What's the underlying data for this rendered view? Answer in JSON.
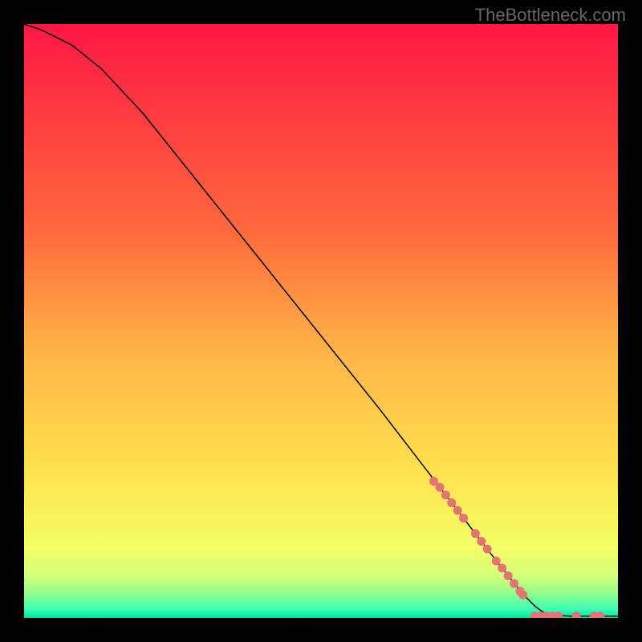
{
  "watermark": "TheBottleneck.com",
  "chart_data": {
    "type": "line",
    "title": "",
    "xlabel": "",
    "ylabel": "",
    "xlim": [
      0,
      100
    ],
    "ylim": [
      0,
      100
    ],
    "gradient_background": {
      "stops": [
        {
          "offset": 0.0,
          "color": "#ff1744"
        },
        {
          "offset": 0.35,
          "color": "#ff6a3d"
        },
        {
          "offset": 0.55,
          "color": "#ffb347"
        },
        {
          "offset": 0.75,
          "color": "#ffe14d"
        },
        {
          "offset": 0.88,
          "color": "#f5ff66"
        },
        {
          "offset": 0.93,
          "color": "#d4ff7a"
        },
        {
          "offset": 0.96,
          "color": "#8fff8f"
        },
        {
          "offset": 0.985,
          "color": "#3dffb3"
        },
        {
          "offset": 1.0,
          "color": "#00e5a0"
        }
      ]
    },
    "curve": {
      "points": [
        {
          "x": 0,
          "y": 100
        },
        {
          "x": 3,
          "y": 99
        },
        {
          "x": 8,
          "y": 96.5
        },
        {
          "x": 13,
          "y": 92.5
        },
        {
          "x": 20,
          "y": 85
        },
        {
          "x": 30,
          "y": 72.5
        },
        {
          "x": 40,
          "y": 60
        },
        {
          "x": 50,
          "y": 47.5
        },
        {
          "x": 60,
          "y": 35
        },
        {
          "x": 70,
          "y": 22
        },
        {
          "x": 75,
          "y": 15.5
        },
        {
          "x": 80,
          "y": 9
        },
        {
          "x": 84,
          "y": 4
        },
        {
          "x": 86,
          "y": 2
        },
        {
          "x": 88,
          "y": 0.5
        },
        {
          "x": 92,
          "y": 0.3
        },
        {
          "x": 100,
          "y": 0.3
        }
      ]
    },
    "markers": {
      "color": "#e57373",
      "radius": 5.5,
      "points": [
        {
          "x": 69,
          "y": 23
        },
        {
          "x": 70,
          "y": 22
        },
        {
          "x": 71,
          "y": 20.7
        },
        {
          "x": 72,
          "y": 19.4
        },
        {
          "x": 73,
          "y": 18.1
        },
        {
          "x": 74,
          "y": 16.8
        },
        {
          "x": 76,
          "y": 14.2
        },
        {
          "x": 77,
          "y": 12.9
        },
        {
          "x": 78,
          "y": 11.6
        },
        {
          "x": 79.5,
          "y": 9.6
        },
        {
          "x": 80.5,
          "y": 8.4
        },
        {
          "x": 81.5,
          "y": 7.1
        },
        {
          "x": 82.5,
          "y": 5.8
        },
        {
          "x": 83.5,
          "y": 4.5
        },
        {
          "x": 84,
          "y": 3.9
        },
        {
          "x": 86,
          "y": 0.3
        },
        {
          "x": 87,
          "y": 0.3
        },
        {
          "x": 88,
          "y": 0.3
        },
        {
          "x": 89,
          "y": 0.3
        },
        {
          "x": 90,
          "y": 0.3
        },
        {
          "x": 93,
          "y": 0.3
        },
        {
          "x": 96,
          "y": 0.3
        },
        {
          "x": 97,
          "y": 0.3
        }
      ]
    }
  }
}
